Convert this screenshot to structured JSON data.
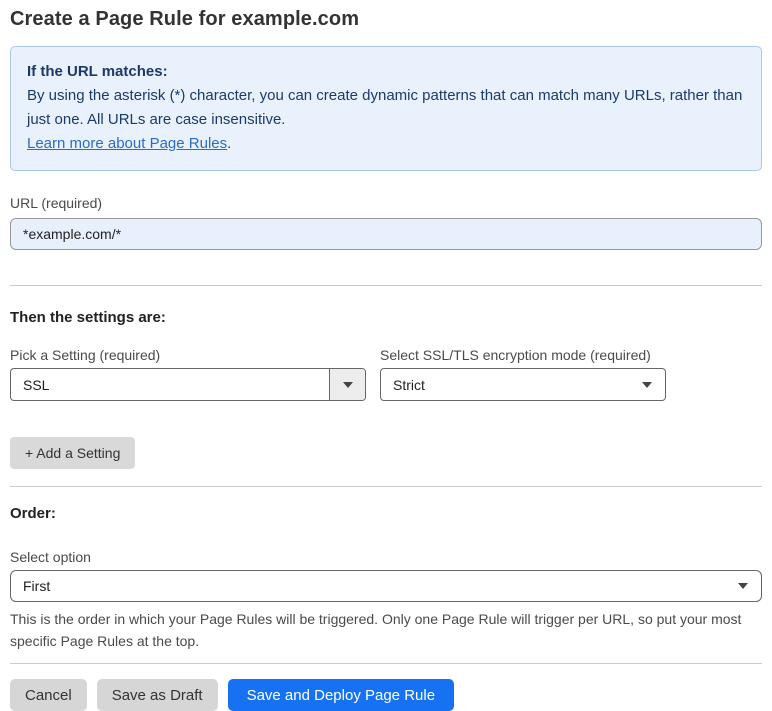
{
  "page": {
    "title": "Create a Page Rule for example.com"
  },
  "info_box": {
    "heading": "If the URL matches:",
    "body": "By using the asterisk (*) character, you can create dynamic patterns that can match many URLs, rather than just one. All URLs are case insensitive.",
    "link_label": "Learn more about Page Rules",
    "link_suffix": "."
  },
  "url_field": {
    "label": "URL (required)",
    "value": "*example.com/*"
  },
  "settings_section": {
    "heading": "Then the settings are:",
    "setting_picker": {
      "label": "Pick a Setting (required)",
      "value": "SSL"
    },
    "ssl_mode_picker": {
      "label": "Select SSL/TLS encryption mode (required)",
      "value": "Strict"
    },
    "add_setting_label": "+ Add a Setting"
  },
  "order_section": {
    "heading": "Order:",
    "select_label": "Select option",
    "value": "First",
    "help_text": "This is the order in which your Page Rules will be triggered. Only one Page Rule will trigger per URL, so put your most specific Page Rules at the top."
  },
  "footer": {
    "cancel_label": "Cancel",
    "save_draft_label": "Save as Draft",
    "save_deploy_label": "Save and Deploy Page Rule"
  },
  "colors": {
    "accent_blue": "#1672F2",
    "info_background": "#E9F2FC",
    "info_border": "#A9C9EC",
    "info_text": "#1B3A6B",
    "link_blue": "#2B6CC4",
    "autofill_input_background": "#E8F0FE"
  }
}
